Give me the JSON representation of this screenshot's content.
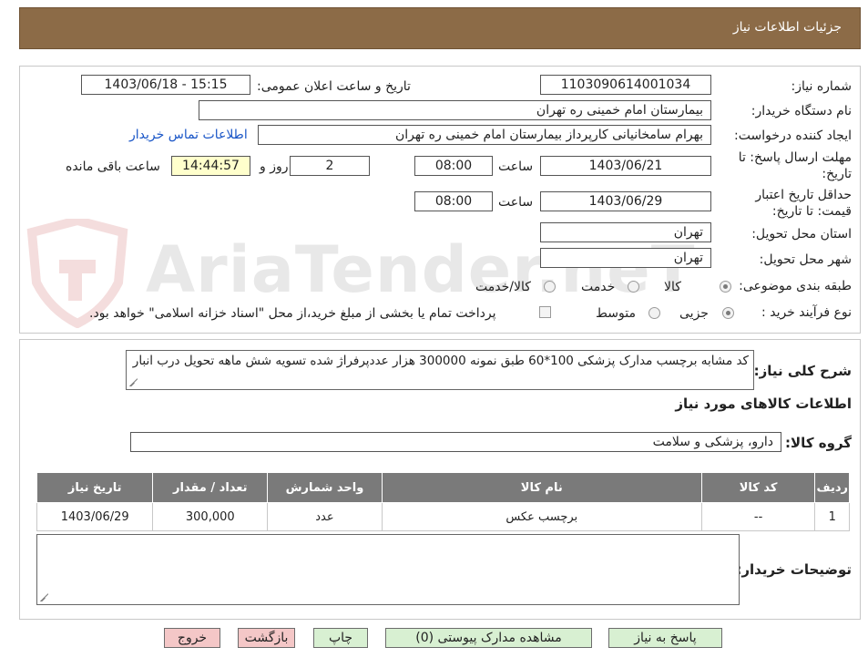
{
  "header": {
    "title": "جزئیات اطلاعات نیاز"
  },
  "fields": {
    "need_number_label": "شماره نیاز:",
    "need_number": "1103090614001034",
    "announce_label": "تاریخ و ساعت اعلان عمومی:",
    "announce_value": "1403/06/18 - 15:15",
    "buyer_org_label": "نام دستگاه خریدار:",
    "buyer_org": "بیمارستان امام خمینی ره  تهران",
    "creator_label": "ایجاد کننده درخواست:",
    "creator": "بهرام  سامخانیانی  کارپرداز بیمارستان امام خمینی ره  تهران",
    "contact_link": "اطلاعات تماس خریدار",
    "deadline_label_1": "مهلت ارسال پاسخ: تا",
    "deadline_label_2": "تاریخ:",
    "deadline_date": "1403/06/21",
    "time_label": "ساعت",
    "deadline_time": "08:00",
    "days_value": "2",
    "days_label": "روز و",
    "remaining_time": "14:44:57",
    "remaining_label": "ساعت باقی مانده",
    "validity_label_1": "حداقل تاریخ اعتبار",
    "validity_label_2": "قیمت: تا تاریخ:",
    "validity_date": "1403/06/29",
    "validity_time": "08:00",
    "province_label": "استان محل تحویل:",
    "province": "تهران",
    "city_label": "شهر محل تحویل:",
    "city": "تهران",
    "category_label": "طبقه بندی موضوعی:",
    "category_options": [
      "کالا",
      "خدمت",
      "کالا/خدمت"
    ],
    "process_label": "نوع فرآیند خرید :",
    "process_options": [
      "جزیی",
      "متوسط"
    ],
    "payment_note": "پرداخت تمام یا بخشی از مبلغ خرید،از محل \"اسناد خزانه اسلامی\" خواهد بود."
  },
  "summary": {
    "label": "شرح کلی نیاز:",
    "text": "کد مشابه برچسب مدارک پزشکی 100*60 طبق نمونه 300000 هزار عددپرفراژ شده تسویه شش ماهه تحویل درب انبار",
    "goods_info_title": "اطلاعات کالاهای مورد نیاز",
    "group_label": "گروه کالا:",
    "group_value": "دارو، پزشکی و سلامت"
  },
  "table": {
    "headers": [
      "ردیف",
      "کد کالا",
      "نام کالا",
      "واحد شمارش",
      "تعداد / مقدار",
      "تاریخ نیاز"
    ],
    "rows": [
      [
        "1",
        "--",
        "برچسب عکس",
        "عدد",
        "300,000",
        "1403/06/29"
      ]
    ]
  },
  "buyer_notes": {
    "label": "توضیحات خریدار:",
    "value": ""
  },
  "buttons": {
    "reply": "پاسخ به نیاز",
    "attachments": "مشاهده مدارک پیوستی (0)",
    "print": "چاپ",
    "back": "بازگشت",
    "exit": "خروج"
  },
  "watermark": {
    "text": "AriaTender.neT"
  },
  "colors": {
    "header_bg": "#8c6b47",
    "table_header_bg": "#7a7a7a",
    "timer_bg": "#ffffcc",
    "button_green": "#d8f0d2",
    "button_pink": "#f4c7c7",
    "link": "#1a56c7"
  }
}
